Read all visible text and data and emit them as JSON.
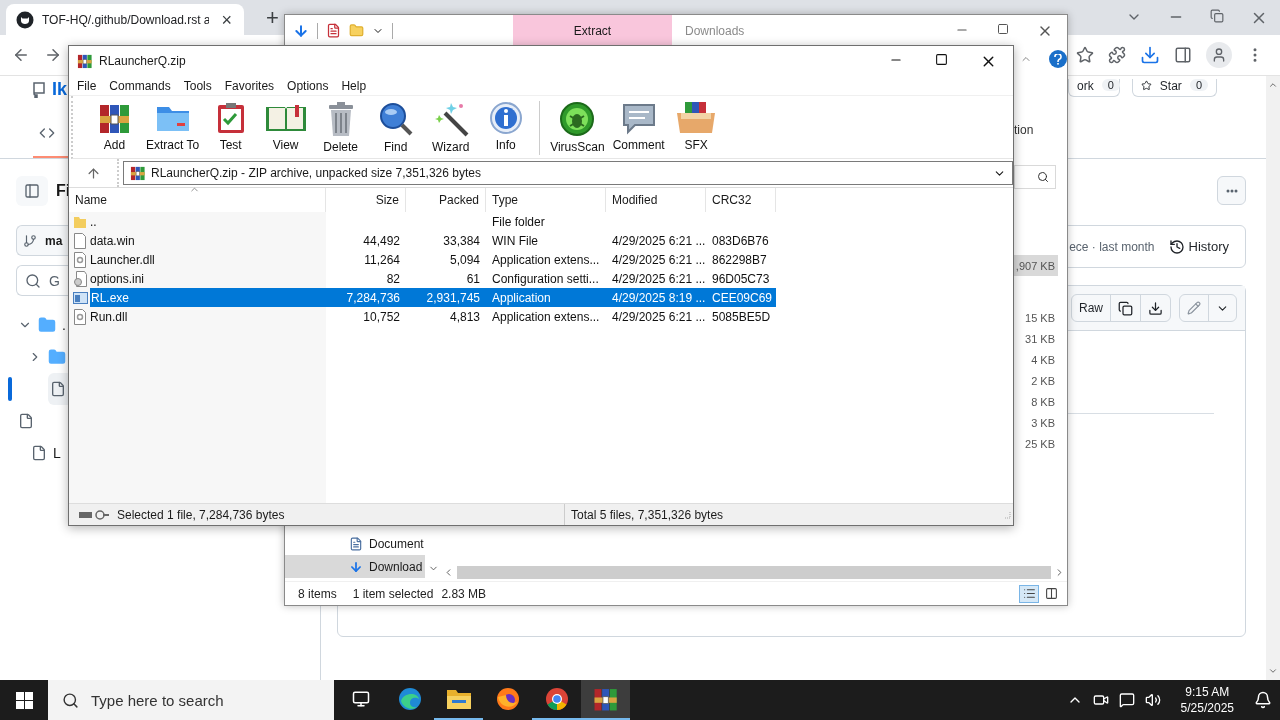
{
  "browser": {
    "tab": {
      "title": "TOF-HQ/.github/Download.rst a",
      "close": "×"
    },
    "new_tab": "+",
    "repo_name": "Ik",
    "fork": {
      "label": "ork",
      "count": "0"
    },
    "star": {
      "label": "Star",
      "count": "0"
    },
    "sidebar": {
      "heading": "Fi",
      "branch": "ma",
      "search_placeholder": "G",
      "tree": [
        {
          "kind": "folder",
          "expanded": true,
          "selected": false,
          "label": ".",
          "children": [
            {
              "kind": "folder",
              "expanded": false,
              "selected": false
            },
            {
              "kind": "file",
              "selected": true
            },
            {
              "kind": "file",
              "selected": false
            }
          ]
        },
        {
          "kind": "file",
          "selected": false,
          "label": "L"
        }
      ]
    },
    "commit_text": "ece · last month",
    "history": "History",
    "raw": "Raw"
  },
  "explorer": {
    "quick_tab": "Extract",
    "title": "Downloads",
    "ribbon_text": "tion",
    "sizes": [
      {
        "size": ",907 KB",
        "selected": true
      },
      {
        "size": "15 KB",
        "selected": false
      },
      {
        "size": "31 KB",
        "selected": false
      },
      {
        "size": "4 KB",
        "selected": false
      },
      {
        "size": "2 KB",
        "selected": false
      },
      {
        "size": "8 KB",
        "selected": false
      },
      {
        "size": "3 KB",
        "selected": false
      },
      {
        "size": "25 KB",
        "selected": false
      }
    ],
    "nav": [
      {
        "label": "Document",
        "kind": "documents",
        "selected": false
      },
      {
        "label": "Download",
        "kind": "downloads",
        "selected": true
      }
    ],
    "status": {
      "items": "8 items",
      "selection": "1 item selected",
      "size": "2.83 MB"
    }
  },
  "winrar": {
    "title": "RLauncherQ.zip",
    "menu": [
      "File",
      "Commands",
      "Tools",
      "Favorites",
      "Options",
      "Help"
    ],
    "toolbar": [
      "Add",
      "Extract To",
      "Test",
      "View",
      "Delete",
      "Find",
      "Wizard",
      "Info",
      "VirusScan",
      "Comment",
      "SFX"
    ],
    "address": "RLauncherQ.zip - ZIP archive, unpacked size 7,351,326 bytes",
    "columns": [
      "Name",
      "Size",
      "Packed",
      "Type",
      "Modified",
      "CRC32"
    ],
    "rows": [
      {
        "kind": "folder",
        "name": "..",
        "size": "",
        "packed": "",
        "type": "File folder",
        "modified": "",
        "crc": "",
        "selected": false
      },
      {
        "kind": "file",
        "name": "data.win",
        "size": "44,492",
        "packed": "33,384",
        "type": "WIN File",
        "modified": "4/29/2025 6:21 ...",
        "crc": "083D6B76",
        "selected": false
      },
      {
        "kind": "library",
        "name": "Launcher.dll",
        "size": "11,264",
        "packed": "5,094",
        "type": "Application extens...",
        "modified": "4/29/2025 6:21 ...",
        "crc": "862298B7",
        "selected": false
      },
      {
        "kind": "settings",
        "name": "options.ini",
        "size": "82",
        "packed": "61",
        "type": "Configuration setti...",
        "modified": "4/29/2025 6:21 ...",
        "crc": "96D05C73",
        "selected": false
      },
      {
        "kind": "app",
        "name": "RL.exe",
        "size": "7,284,736",
        "packed": "2,931,745",
        "type": "Application",
        "modified": "4/29/2025 8:19 ...",
        "crc": "CEE09C69",
        "selected": true
      },
      {
        "kind": "library",
        "name": "Run.dll",
        "size": "10,752",
        "packed": "4,813",
        "type": "Application extens...",
        "modified": "4/29/2025 6:21 ...",
        "crc": "5085BE5D",
        "selected": false
      }
    ],
    "status_left": "Selected 1 file, 7,284,736 bytes",
    "status_right": "Total 5 files, 7,351,326 bytes"
  },
  "taskbar": {
    "search_placeholder": "Type here to search",
    "apps": [
      {
        "kind": "edge",
        "running": false,
        "selected": false
      },
      {
        "kind": "files",
        "running": true,
        "selected": false
      },
      {
        "kind": "firefox",
        "running": false,
        "selected": false
      },
      {
        "kind": "chrome",
        "running": true,
        "selected": false
      },
      {
        "kind": "archiver",
        "running": true,
        "selected": true
      }
    ],
    "time": "9:15 AM",
    "date": "5/25/2025"
  }
}
